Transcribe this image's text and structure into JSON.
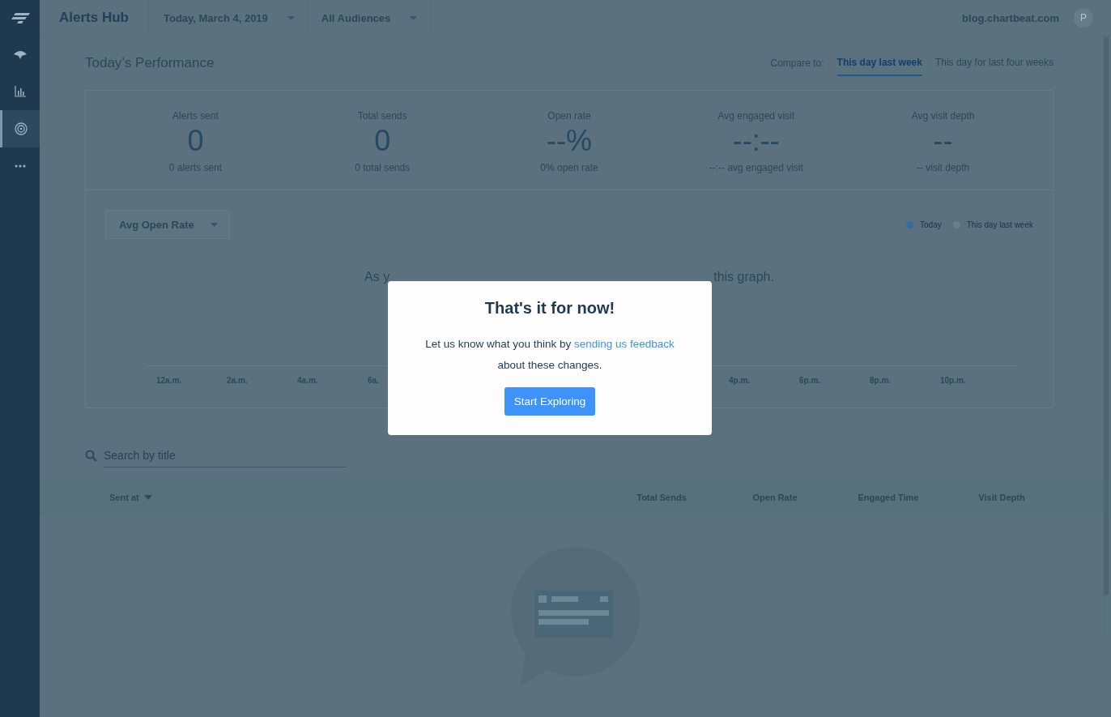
{
  "sidebar": {
    "items": [
      {
        "kind": "gauge",
        "selected": false
      },
      {
        "kind": "chart",
        "selected": false
      },
      {
        "kind": "target",
        "selected": true
      },
      {
        "kind": "more",
        "selected": false
      }
    ]
  },
  "topbar": {
    "title": "Alerts Hub",
    "date": "Today, March 4, 2019",
    "audience": "All Audiences",
    "site": "blog.chartbeat.com",
    "avatar": "P"
  },
  "section": {
    "title": "Today’s Performance",
    "compare_label": "Compare to:",
    "compare_tabs": [
      {
        "label": "This day last week",
        "selected": true
      },
      {
        "label": "This day for last four weeks",
        "selected": false
      }
    ]
  },
  "stats": [
    {
      "label": "Alerts sent",
      "value": "0",
      "caption": "0 alerts sent"
    },
    {
      "label": "Total sends",
      "value": "0",
      "caption": "0 total sends"
    },
    {
      "label": "Open rate",
      "value": "--%",
      "caption": "0% open rate"
    },
    {
      "label": "Avg engaged visit",
      "value": "--:--",
      "caption": "--:-- avg engaged visit"
    },
    {
      "label": "Avg visit depth",
      "value": "--",
      "caption": "-- visit depth"
    }
  ],
  "graph": {
    "metric": "Avg Open Rate",
    "legend": [
      {
        "label": "Today",
        "color": "#2f6ea3"
      },
      {
        "label": "This day last week",
        "color": "#6a7f8b"
      }
    ],
    "message_left": "As y",
    "message_right": "this graph.",
    "ticks_left": [
      "12a.m.",
      "2a.m.",
      "4a.m.",
      "6a."
    ],
    "ticks_right": [
      "4p.m.",
      "6p.m.",
      "8p.m.",
      "10p.m."
    ]
  },
  "search": {
    "placeholder": "Search by title"
  },
  "table": {
    "columns": [
      {
        "label": "Sent at",
        "sorted": true
      },
      {
        "label": "Total Sends",
        "sorted": false
      },
      {
        "label": "Open Rate",
        "sorted": false
      },
      {
        "label": "Engaged Time",
        "sorted": false
      },
      {
        "label": "Visit Depth",
        "sorted": false
      }
    ]
  },
  "modal": {
    "title": "That's it for now!",
    "text_before": "Let us know what you think by",
    "link": "sending us feedback",
    "text_after": "about these changes.",
    "button": "Start Exploring"
  }
}
